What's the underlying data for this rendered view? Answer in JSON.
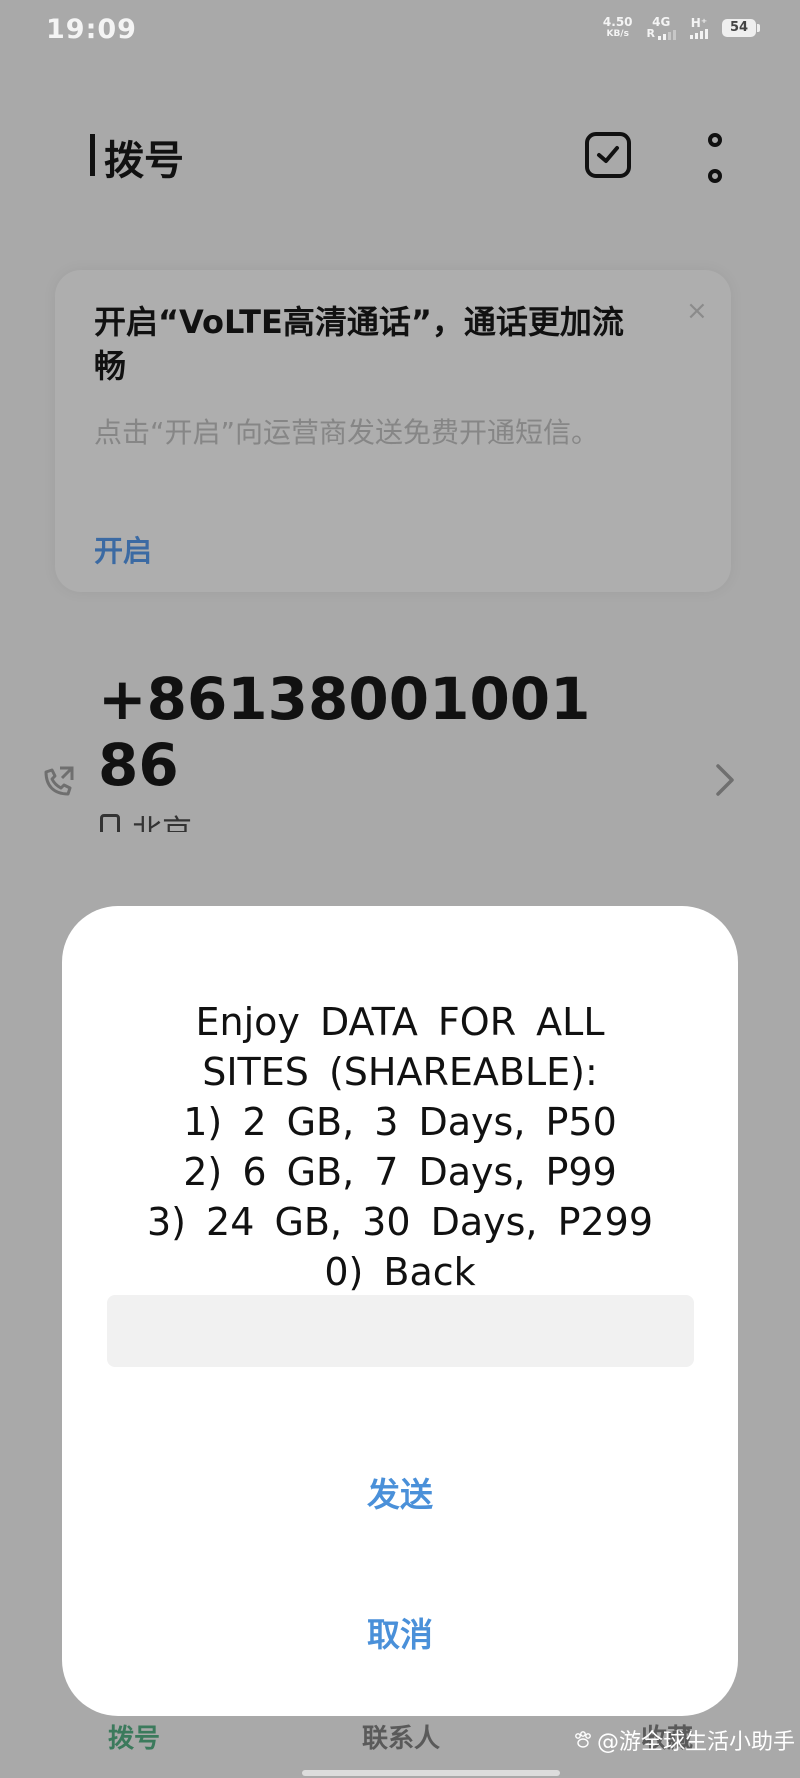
{
  "status_bar": {
    "time": "19:09",
    "net_speed": "4.50",
    "net_speed_unit": "KB/s",
    "network_1": "4G",
    "roaming": "R",
    "network_2": "H⁺",
    "battery": "54"
  },
  "header": {
    "title": "拨号",
    "select_icon": "checkbox-icon",
    "more_icon": "more-vertical-icon"
  },
  "volte_banner": {
    "title": "开启“VoLTE高清通话”，通话更加流畅",
    "description": "点击“开启”向运营商发送免费开通短信。",
    "action_label": "开启",
    "close_label": "×"
  },
  "dialer": {
    "number": "+8613800100186",
    "location": "北京"
  },
  "ussd_dialog": {
    "message_lines": [
      "Enjoy DATA FOR ALL",
      "SITES (SHAREABLE):",
      "1) 2 GB, 3 Days, P50",
      "2) 6 GB, 7 Days, P99",
      "3) 24 GB, 30 Days, P299",
      "0) Back"
    ],
    "input_value": "",
    "send_label": "发送",
    "cancel_label": "取消"
  },
  "bottom_nav": {
    "tabs": [
      {
        "label": "拨号"
      },
      {
        "label": "联系人"
      },
      {
        "label": "收藏"
      }
    ]
  },
  "watermark": "@游全球生活小助手",
  "colors": {
    "accent": "#4a90d9",
    "link": "#3b6aa3",
    "active_tab": "#3b7a5c",
    "overlay_bg": "#a9a9a9"
  }
}
